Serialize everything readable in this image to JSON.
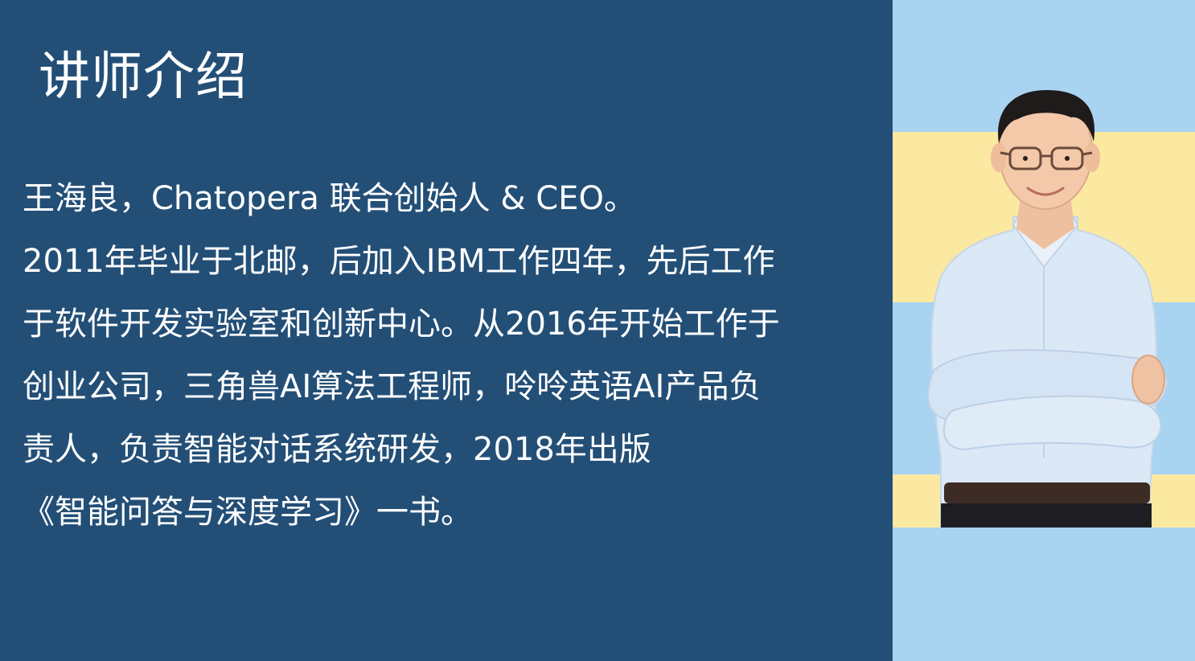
{
  "slide": {
    "title": "讲师介绍",
    "bio_lines": [
      "王海良，Chatopera 联合创始人 & CEO。",
      "2011年毕业于北邮，后加入IBM工作四年，先后工作",
      "于软件开发实验室和创新中心。从2016年开始工作于",
      "创业公司，三角兽AI算法工程师，呤呤英语AI产品负",
      "责人，负责智能对话系统研发，2018年出版",
      "《智能问答与深度学习》一书。"
    ]
  },
  "colors": {
    "main_panel": "#234f77",
    "light_blue": "#a8d4f2",
    "yellow_stripe": "#fbe9a1",
    "text": "#ffffff"
  }
}
